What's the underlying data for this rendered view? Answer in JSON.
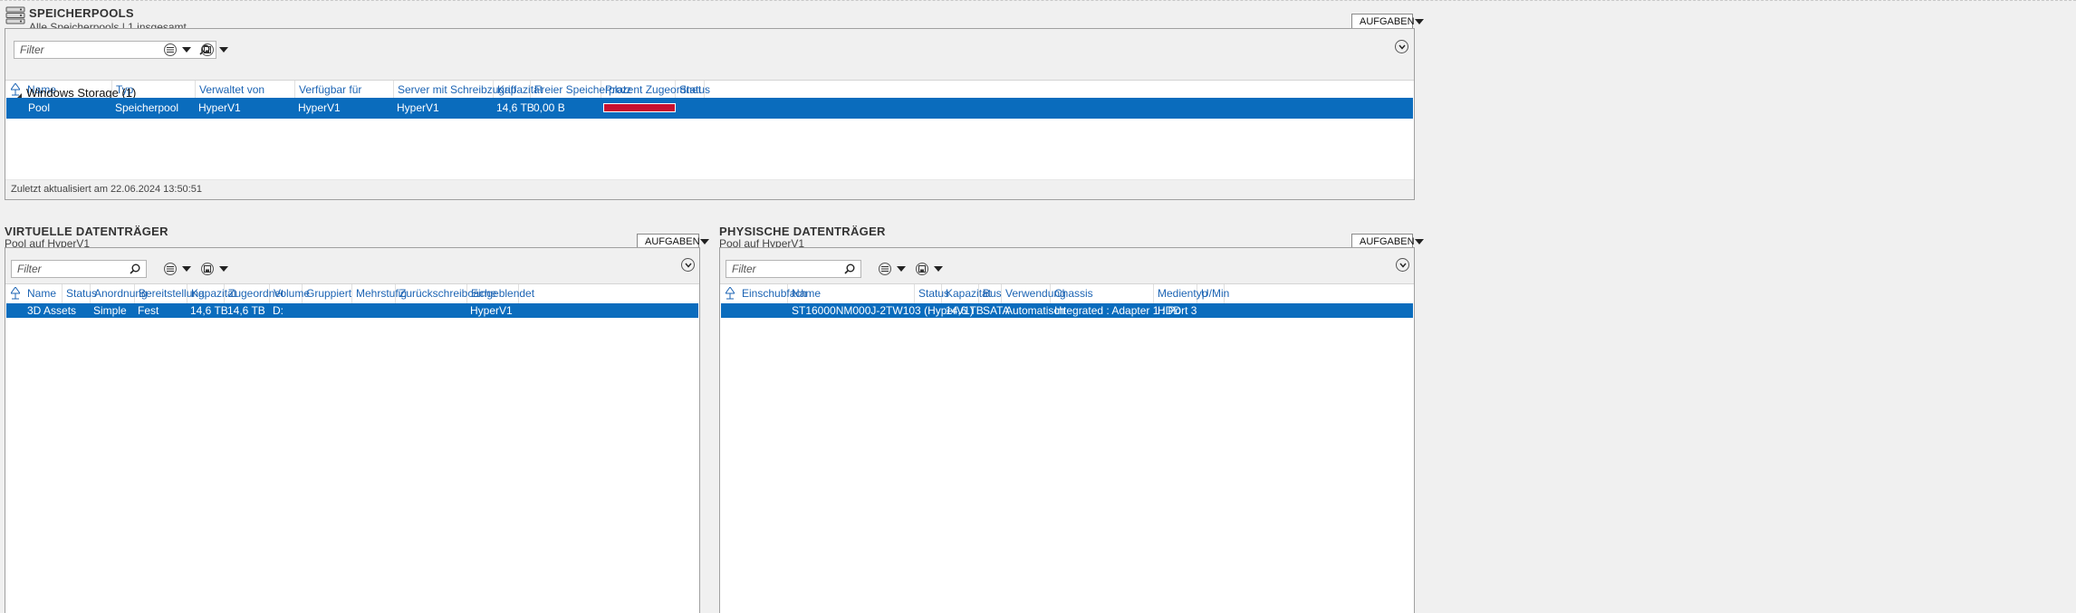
{
  "pools": {
    "title": "SPEICHERPOOLS",
    "subtitle": "Alle Speicherpools | 1 insgesamt",
    "tasks_label": "AUFGABEN",
    "filter_placeholder": "Filter",
    "columns": [
      "Name",
      "Typ",
      "Verwaltet von",
      "Verfügbar für",
      "Server mit Schreibzugriff",
      "Kapazität",
      "Freier Speicherplatz",
      "Prozent Zugeordnet",
      "Status"
    ],
    "group_label": "Windows Storage (1)",
    "row": {
      "name": "Pool",
      "typ": "Speicherpool",
      "verwaltet_von": "HyperV1",
      "verfuegbar_fuer": "HyperV1",
      "server": "HyperV1",
      "kapazitaet": "14,6 TB",
      "frei": "0,00 B",
      "prozent_zugeordnet": 100,
      "status": ""
    },
    "last_updated": "Zuletzt aktualisiert am 22.06.2024 13:50:51"
  },
  "virtual": {
    "title": "VIRTUELLE DATENTRÄGER",
    "subtitle": "Pool auf HyperV1",
    "tasks_label": "AUFGABEN",
    "filter_placeholder": "Filter",
    "columns": [
      "Name",
      "Status",
      "Anordnung",
      "Bereitstellung",
      "Kapazität",
      "Zugeordnet",
      "Volume",
      "Gruppiert",
      "Mehrstufig",
      "Zurückschreibcache",
      "Eingeblendet"
    ],
    "row": [
      "3D Assets",
      "",
      "Simple",
      "Fest",
      "14,6 TB",
      "14,6 TB",
      "D:",
      "",
      "",
      "",
      "HyperV1"
    ]
  },
  "physical": {
    "title": "PHYSISCHE DATENTRÄGER",
    "subtitle": "Pool auf HyperV1",
    "tasks_label": "AUFGABEN",
    "filter_placeholder": "Filter",
    "columns": [
      "Einschubfach",
      "Name",
      "Status",
      "Kapazität",
      "Bus",
      "Verwendung",
      "Chassis",
      "Medientyp",
      "U/Min"
    ],
    "row": [
      "",
      "ST16000NM000J-2TW103 (HyperV1)",
      "",
      "14,6 TB",
      "SATA",
      "Automatisch",
      "Integrated : Adapter 1 : Port 3",
      "HDD",
      ""
    ]
  },
  "icons": {
    "server": "storage-server-icon",
    "search": "search-icon",
    "list_view": "list-view-icon",
    "save_query": "save-query-icon",
    "collapse": "collapse-chevron-icon",
    "sort": "sort-columns-icon"
  },
  "colors": {
    "selection": "#0a6cbd",
    "header_text": "#1c64b4",
    "progress_full": "#c8102e"
  }
}
